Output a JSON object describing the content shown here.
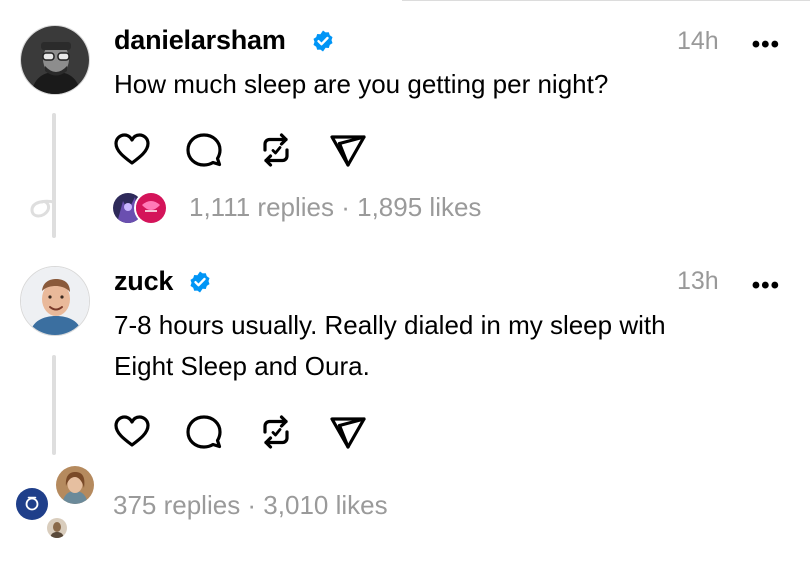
{
  "posts": [
    {
      "username": "danielarsham",
      "time": "14h",
      "more": "•••",
      "text": "How much sleep are you getting per night?",
      "stats": "1,111 replies · 1,895 likes"
    },
    {
      "username": "zuck",
      "time": "13h",
      "more": "•••",
      "text_line1": "7-8 hours usually. Really dialed in my sleep with",
      "text_line2": "Eight Sleep and Oura.",
      "stats": "375 replies · 3,010 likes"
    }
  ],
  "colors": {
    "verified": "#0095f6",
    "muted": "#9a9a9a",
    "thread_line": "#dedede"
  },
  "icons": [
    "heart-icon",
    "comment-icon",
    "repost-icon",
    "share-icon",
    "verified-icon",
    "more-icon",
    "thread-loop-icon"
  ]
}
